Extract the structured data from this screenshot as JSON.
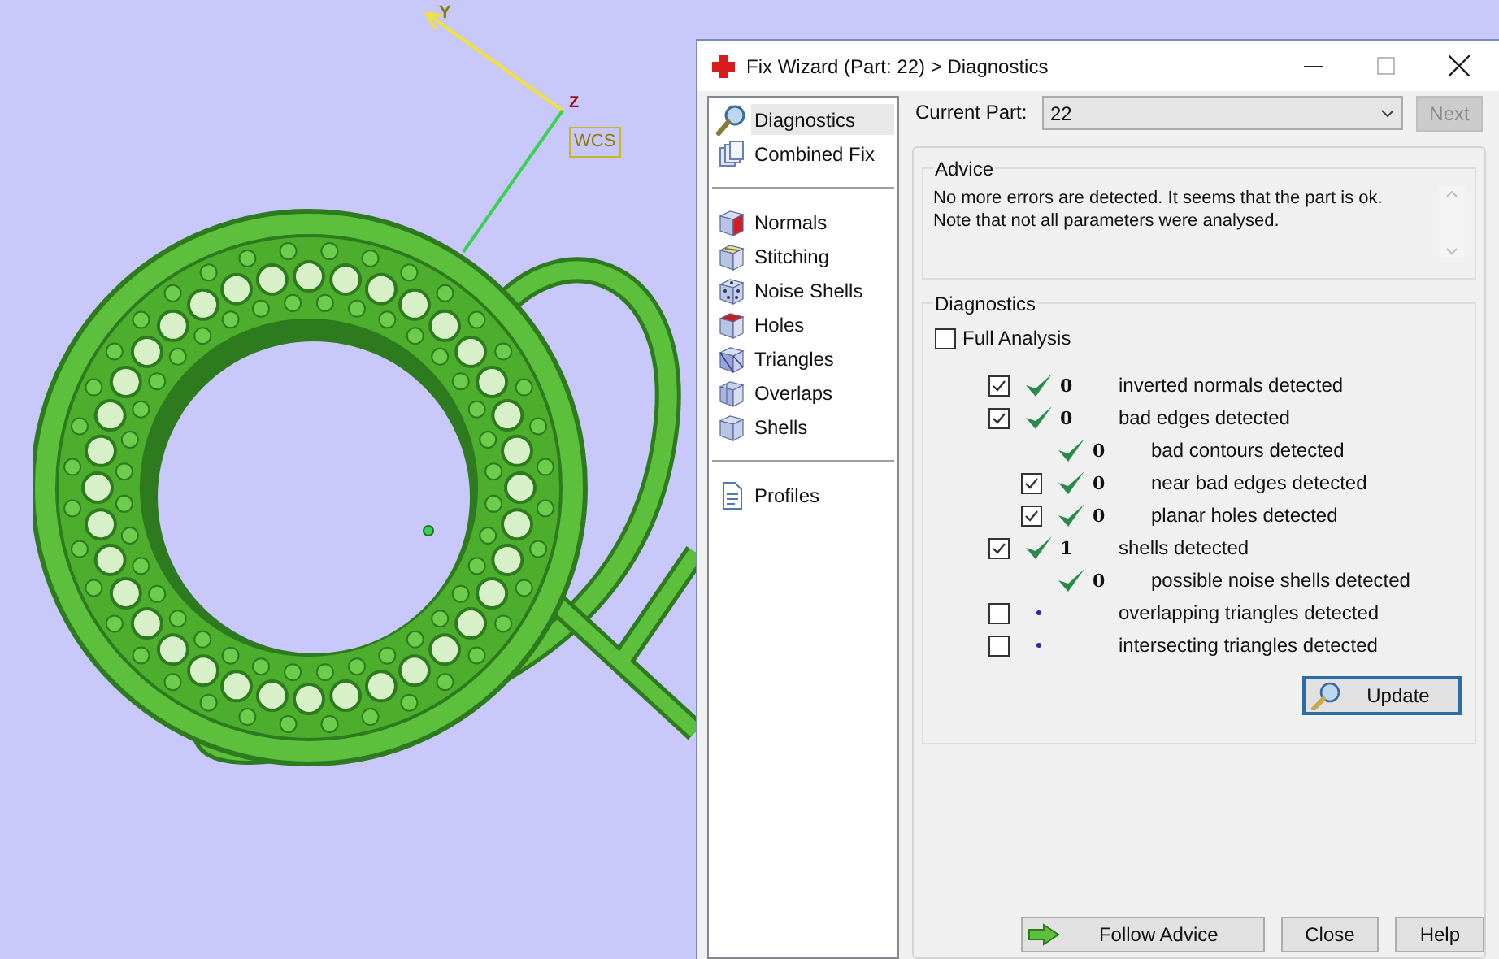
{
  "viewport": {
    "axis_y": "Y",
    "axis_z": "Z",
    "wcs_label": "WCS"
  },
  "window": {
    "title": "Fix Wizard (Part: 22) > Diagnostics"
  },
  "sidebar": {
    "groups": [
      {
        "items": [
          {
            "label": "Diagnostics",
            "selected": true
          },
          {
            "label": "Combined Fix",
            "selected": false
          }
        ]
      },
      {
        "items": [
          {
            "label": "Normals",
            "selected": false
          },
          {
            "label": "Stitching",
            "selected": false
          },
          {
            "label": "Noise Shells",
            "selected": false
          },
          {
            "label": "Holes",
            "selected": false
          },
          {
            "label": "Triangles",
            "selected": false
          },
          {
            "label": "Overlaps",
            "selected": false
          },
          {
            "label": "Shells",
            "selected": false
          }
        ]
      },
      {
        "items": [
          {
            "label": "Profiles",
            "selected": false
          }
        ]
      }
    ]
  },
  "current_part": {
    "label": "Current Part:",
    "value": "22"
  },
  "next_button": {
    "label": "Next",
    "disabled": true
  },
  "advice": {
    "title": "Advice",
    "text": "No more errors are detected. It seems that the part is ok.\nNote that not all parameters were analysed."
  },
  "diagnostics": {
    "title": "Diagnostics",
    "full_analysis": {
      "label": "Full Analysis",
      "checked": false
    },
    "rows": [
      {
        "kind": "checkbox",
        "checked": true,
        "passed": true,
        "count": "0",
        "label": "inverted normals detected"
      },
      {
        "kind": "checkbox",
        "checked": true,
        "passed": true,
        "count": "0",
        "label": "bad edges detected",
        "children": [
          {
            "kind": "plain",
            "passed": true,
            "count": "0",
            "label": "bad contours detected"
          },
          {
            "kind": "checkbox",
            "checked": true,
            "passed": true,
            "count": "0",
            "label": "near bad edges detected"
          },
          {
            "kind": "checkbox",
            "checked": true,
            "passed": true,
            "count": "0",
            "label": "planar holes detected"
          }
        ]
      },
      {
        "kind": "checkbox",
        "checked": true,
        "passed": true,
        "count": "1",
        "label": "shells detected",
        "children": [
          {
            "kind": "plain",
            "passed": true,
            "count": "0",
            "label": "possible noise shells detected"
          }
        ]
      },
      {
        "kind": "checkbox",
        "checked": false,
        "passed": false,
        "label": "overlapping triangles detected"
      },
      {
        "kind": "checkbox",
        "checked": false,
        "passed": false,
        "label": "intersecting triangles detected"
      }
    ],
    "update_button": "Update"
  },
  "footer_buttons": [
    {
      "label": "Follow Advice",
      "kind": "with_icon"
    },
    {
      "label": "Close",
      "kind": "plain"
    },
    {
      "label": "Help",
      "kind": "plain"
    }
  ]
}
